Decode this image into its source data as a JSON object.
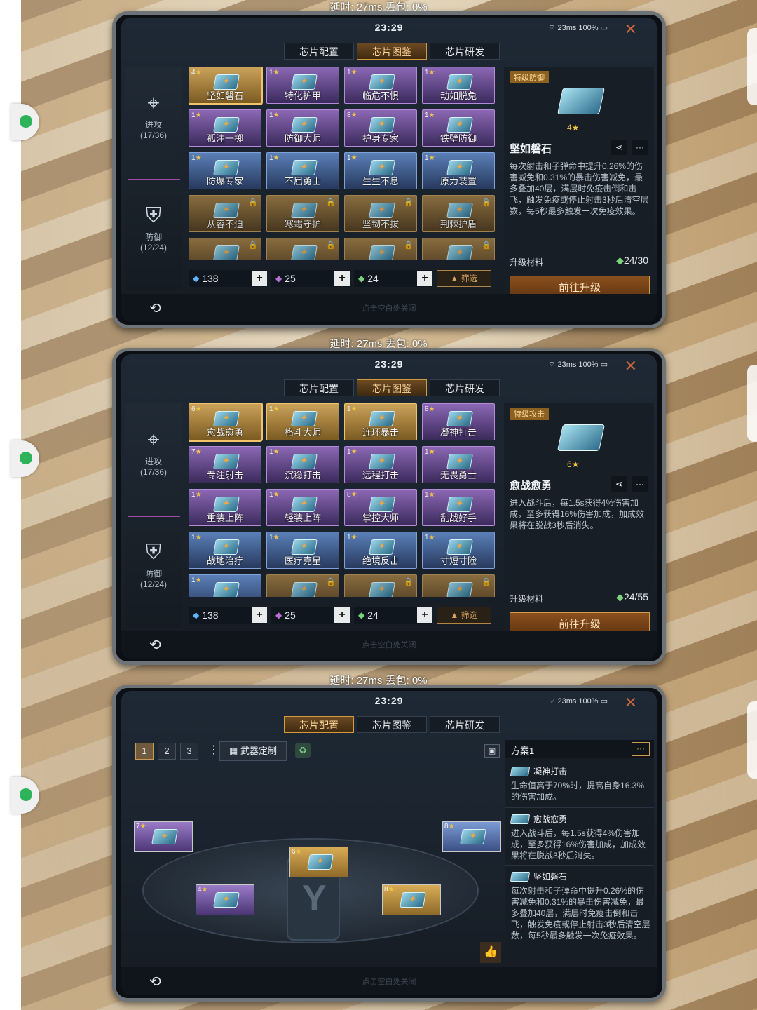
{
  "net_text": "延时: 27ms 丢包: 0%",
  "clock": "23:29",
  "status": "23ms 100%",
  "tabs": [
    "芯片配置",
    "芯片图鉴",
    "芯片研发"
  ],
  "sidebar": {
    "attack_label": "进攻",
    "attack_count": "(17/36)",
    "defense_label": "防御",
    "defense_count": "(12/24)"
  },
  "resources": {
    "blue": "138",
    "purple": "25",
    "gold": "24",
    "filter": "筛选"
  },
  "bottom_hint": "点击空白处关闭",
  "panel1": {
    "chips": [
      {
        "lvl": "4",
        "name": "坚如磐石",
        "tier": "gold",
        "selected": true
      },
      {
        "lvl": "1",
        "name": "特化护甲",
        "tier": "purple"
      },
      {
        "lvl": "1",
        "name": "临危不惧",
        "tier": "purple"
      },
      {
        "lvl": "1",
        "name": "动如脱兔",
        "tier": "purple"
      },
      {
        "lvl": "1",
        "name": "孤注一掷",
        "tier": "purple"
      },
      {
        "lvl": "1",
        "name": "防御大师",
        "tier": "purple"
      },
      {
        "lvl": "8",
        "name": "护身专家",
        "tier": "purple"
      },
      {
        "lvl": "1",
        "name": "铁壁防御",
        "tier": "purple"
      },
      {
        "lvl": "1",
        "name": "防爆专家",
        "tier": "blue"
      },
      {
        "lvl": "1",
        "name": "不屈勇士",
        "tier": "blue"
      },
      {
        "lvl": "1",
        "name": "生生不息",
        "tier": "blue"
      },
      {
        "lvl": "1",
        "name": "原力装置",
        "tier": "blue"
      },
      {
        "lvl": "",
        "name": "从容不迫",
        "tier": "brown",
        "locked": true
      },
      {
        "lvl": "",
        "name": "寒霜守护",
        "tier": "brown",
        "locked": true
      },
      {
        "lvl": "",
        "name": "坚韧不拔",
        "tier": "brown",
        "locked": true
      },
      {
        "lvl": "",
        "name": "荆棘护盾",
        "tier": "brown",
        "locked": true
      },
      {
        "lvl": "",
        "name": "",
        "tier": "brown",
        "locked": true
      },
      {
        "lvl": "",
        "name": "",
        "tier": "brown",
        "locked": true
      },
      {
        "lvl": "",
        "name": "",
        "tier": "brown",
        "locked": true
      },
      {
        "lvl": "",
        "name": "",
        "tier": "brown",
        "locked": true
      }
    ],
    "detail": {
      "badge": "特级防御",
      "stars": "4★",
      "name": "坚如磐石",
      "desc": "每次射击和子弹命中提升0.26%的伤害减免和0.31%的暴击伤害减免，最多叠加40层，满层时免疫击倒和击飞，触发免疫或停止射击3秒后清空层数，每5秒最多触发一次免疫效果。",
      "mat_label": "升级材料",
      "mat_value": "24/30",
      "button": "前往升级"
    }
  },
  "panel2": {
    "chips": [
      {
        "lvl": "6",
        "name": "愈战愈勇",
        "tier": "gold",
        "selected": true
      },
      {
        "lvl": "1",
        "name": "格斗大师",
        "tier": "gold"
      },
      {
        "lvl": "1",
        "name": "连环暴击",
        "tier": "gold"
      },
      {
        "lvl": "8",
        "name": "凝神打击",
        "tier": "purple"
      },
      {
        "lvl": "7",
        "name": "专注射击",
        "tier": "purple"
      },
      {
        "lvl": "1",
        "name": "沉稳打击",
        "tier": "purple"
      },
      {
        "lvl": "1",
        "name": "远程打击",
        "tier": "purple"
      },
      {
        "lvl": "1",
        "name": "无畏勇士",
        "tier": "purple"
      },
      {
        "lvl": "1",
        "name": "重装上阵",
        "tier": "purple"
      },
      {
        "lvl": "1",
        "name": "轻装上阵",
        "tier": "purple"
      },
      {
        "lvl": "8",
        "name": "掌控大师",
        "tier": "purple"
      },
      {
        "lvl": "1",
        "name": "乱战好手",
        "tier": "purple"
      },
      {
        "lvl": "1",
        "name": "战地治疗",
        "tier": "blue"
      },
      {
        "lvl": "1",
        "name": "医疗克星",
        "tier": "blue"
      },
      {
        "lvl": "1",
        "name": "绝境反击",
        "tier": "blue"
      },
      {
        "lvl": "1",
        "name": "寸短寸险",
        "tier": "blue"
      },
      {
        "lvl": "1",
        "name": "",
        "tier": "blue"
      },
      {
        "lvl": "",
        "name": "",
        "tier": "brown",
        "locked": true
      },
      {
        "lvl": "",
        "name": "",
        "tier": "brown",
        "locked": true
      },
      {
        "lvl": "",
        "name": "",
        "tier": "brown",
        "locked": true
      }
    ],
    "detail": {
      "badge": "特级攻击",
      "stars": "6★",
      "name": "愈战愈勇",
      "desc": "进入战斗后，每1.5s获得4%伤害加成，至多获得16%伤害加成，加成效果将在脱战3秒后消失。",
      "mat_label": "升级材料",
      "mat_value": "24/55",
      "button": "前往升级"
    }
  },
  "panel3": {
    "schemes": [
      "1",
      "2",
      "3"
    ],
    "weapon_button": "武器定制",
    "plan_title": "方案1",
    "plan_more": "···",
    "slots": [
      {
        "lvl": "7"
      },
      {
        "lvl": "8"
      },
      {
        "lvl": "6"
      },
      {
        "lvl": "4"
      },
      {
        "lvl": "8"
      }
    ],
    "entries": [
      {
        "name": "凝神打击",
        "desc": "生命值高于70%时，提高自身16.3%的伤害加成。"
      },
      {
        "name": "愈战愈勇",
        "desc": "进入战斗后，每1.5s获得4%伤害加成，至多获得16%伤害加成，加成效果将在脱战3秒后消失。"
      },
      {
        "name": "坚如磐石",
        "desc": "每次射击和子弹命中提升0.26%的伤害减免和0.31%的暴击伤害减免，最多叠加40层，满层时免疫击倒和击飞，触发免疫或停止射击3秒后清空层数，每5秒最多触发一次免疫效果。"
      }
    ]
  },
  "colors": {
    "active_tab": "#d59a3d",
    "upgrade_button": "#8a4f1e",
    "material_green": "#7bd37b"
  }
}
